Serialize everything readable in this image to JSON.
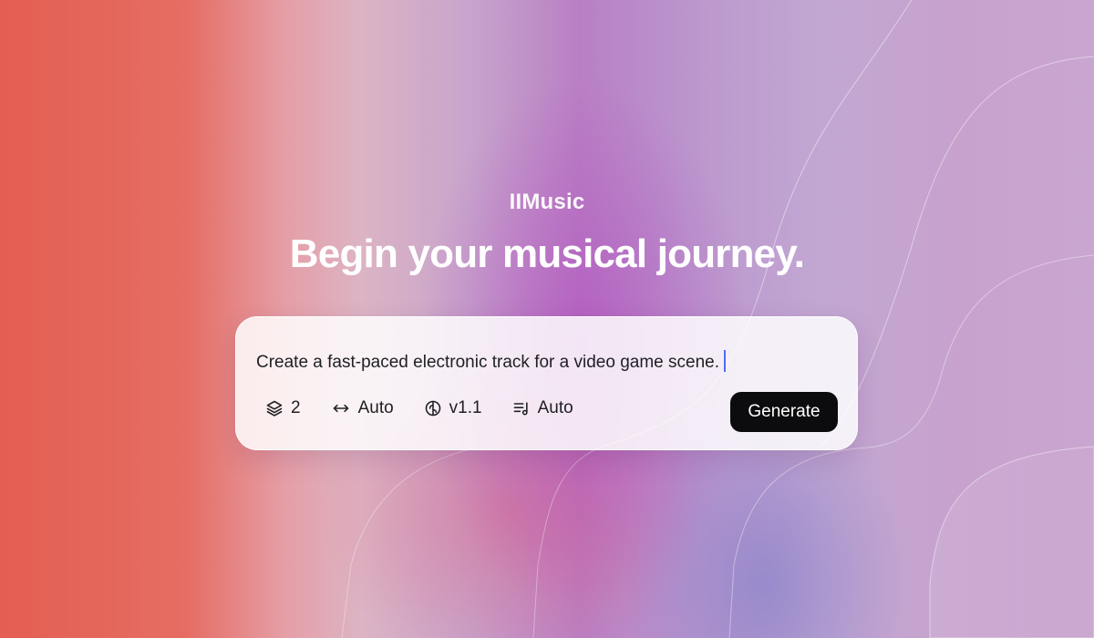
{
  "brand": {
    "name": "IIMusic"
  },
  "hero": {
    "headline": "Begin your musical journey."
  },
  "prompt": {
    "text": "Create a fast-paced electronic track for a video game scene."
  },
  "options": [
    {
      "icon": "layers-icon",
      "value": "2"
    },
    {
      "icon": "arrows-horizontal-icon",
      "value": "Auto"
    },
    {
      "icon": "brain-icon",
      "value": "v1.1"
    },
    {
      "icon": "music-list-icon",
      "value": "Auto"
    }
  ],
  "actions": {
    "generate_label": "Generate"
  },
  "colors": {
    "accent_caret": "#4f6cf0",
    "button_bg": "#0c0c0f",
    "text_white": "#ffffff"
  }
}
